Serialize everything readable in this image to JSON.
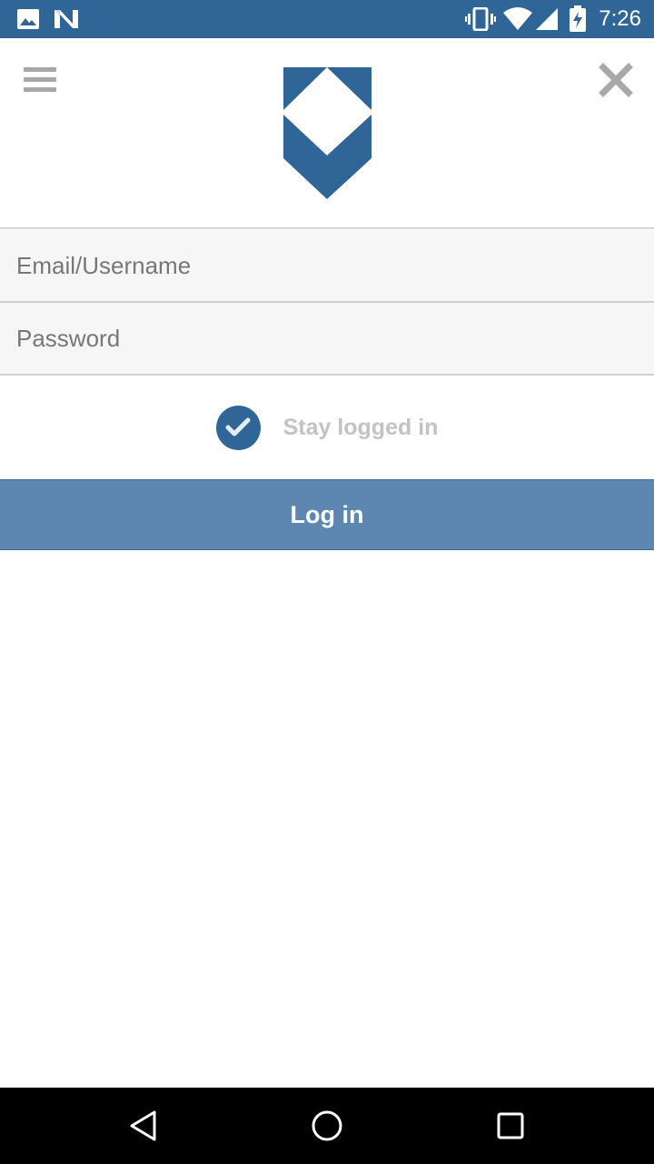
{
  "status_bar": {
    "time": "7:26",
    "icons": [
      "image-icon",
      "n-icon",
      "vibrate-icon",
      "wifi-icon",
      "signal-icon",
      "battery-icon"
    ],
    "background": "#2f6597"
  },
  "header": {
    "menu_icon": "hamburger-menu-icon",
    "close_icon": "close-icon",
    "logo_icon": "shield-logo",
    "brand_color": "#2f6597"
  },
  "form": {
    "email_placeholder": "Email/Username",
    "password_placeholder": "Password",
    "stay_logged_in_label": "Stay logged in",
    "stay_logged_in_checked": true,
    "login_button_label": "Log in",
    "login_button_color": "#5d87b0"
  },
  "nav_bar": {
    "icons": [
      "back-icon",
      "home-icon",
      "recents-icon"
    ]
  }
}
